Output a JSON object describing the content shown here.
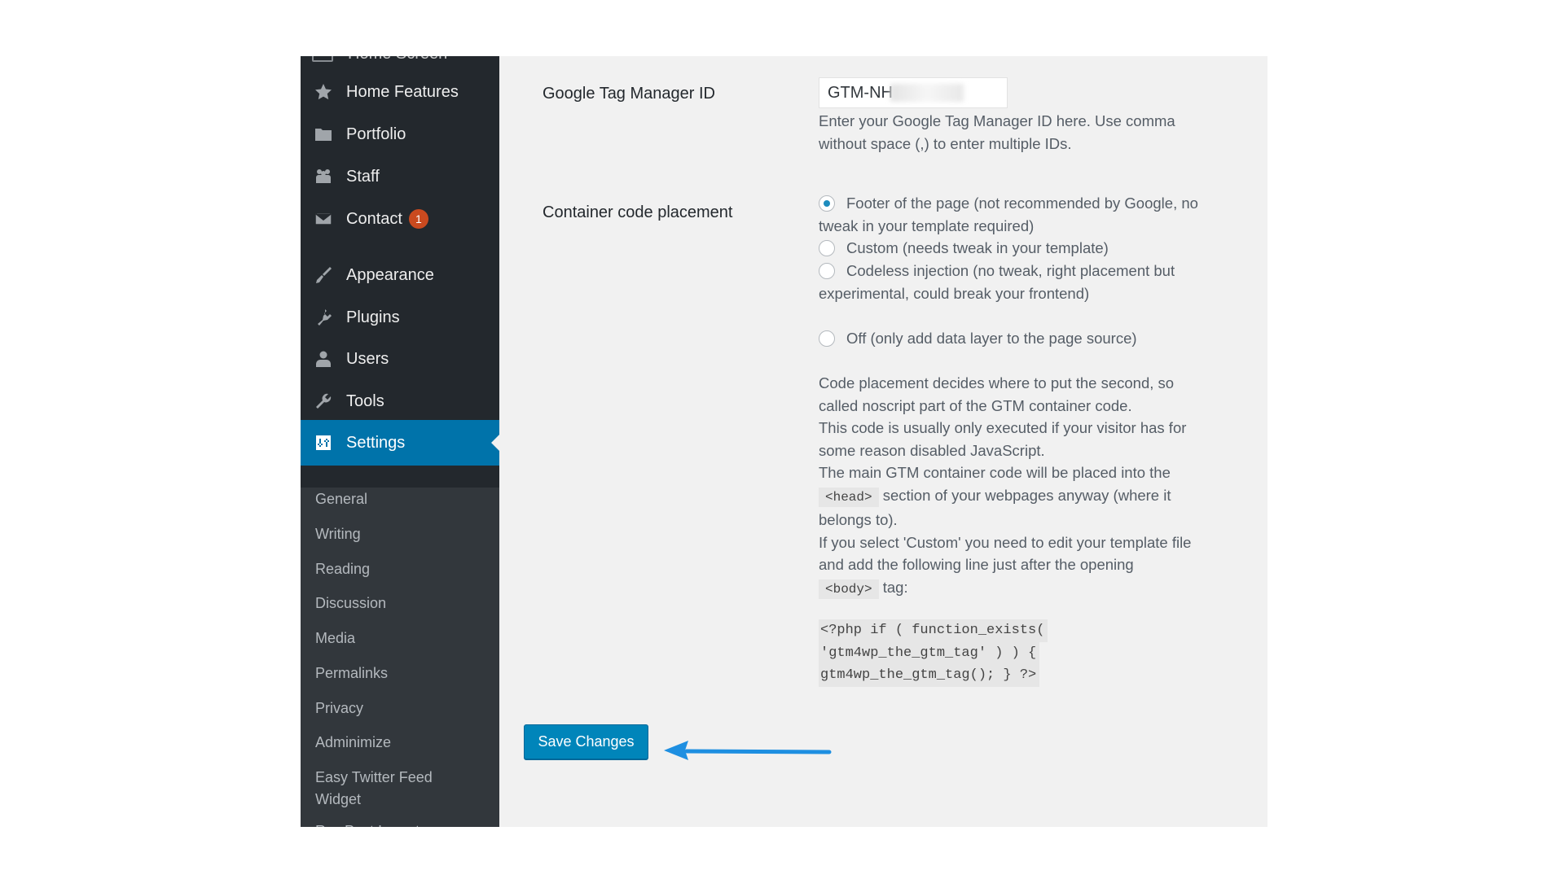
{
  "sidebar": {
    "top_partial_item": "Home Screen",
    "items": [
      {
        "label": "Home Features",
        "icon": "star-icon"
      },
      {
        "label": "Portfolio",
        "icon": "folder-icon"
      },
      {
        "label": "Staff",
        "icon": "group-icon"
      },
      {
        "label": "Contact",
        "icon": "mail-icon",
        "badge": "1"
      },
      {
        "label": "Appearance",
        "icon": "paintbrush-icon"
      },
      {
        "label": "Plugins",
        "icon": "plugin-icon"
      },
      {
        "label": "Users",
        "icon": "user-icon"
      },
      {
        "label": "Tools",
        "icon": "wrench-icon"
      },
      {
        "label": "Settings",
        "icon": "settings-icon",
        "active": true
      }
    ],
    "submenu": [
      "General",
      "Writing",
      "Reading",
      "Discussion",
      "Media",
      "Permalinks",
      "Privacy",
      "Adminimize",
      "Easy Twitter Feed Widget",
      "Rss Post Importer"
    ]
  },
  "form": {
    "gtm_id": {
      "label": "Google Tag Manager ID",
      "value": "GTM-NH",
      "description": "Enter your Google Tag Manager ID here. Use comma without space (,) to enter multiple IDs."
    },
    "placement": {
      "label": "Container code placement",
      "options": [
        {
          "label": "Footer of the page (not recommended by Google, no tweak in your template required)",
          "checked": true
        },
        {
          "label": "Custom (needs tweak in your template)",
          "checked": false
        },
        {
          "label": "Codeless injection (no tweak, right placement but experimental, could break your frontend)",
          "checked": false
        },
        {
          "label": "Off (only add data layer to the page source)",
          "checked": false
        }
      ],
      "help": {
        "p1": "Code placement decides where to put the second, so called noscript part of the GTM container code.",
        "p2": "This code is usually only executed if your visitor has for some reason disabled JavaScript.",
        "p3_before": "The main GTM container code will be placed into the",
        "p3_code": "<head>",
        "p3_after": "section of your webpages anyway (where it belongs to).",
        "p4_before": "If you select 'Custom' you need to edit your template file and add the following line just after the opening",
        "p4_code": "<body>",
        "p4_after": "tag:",
        "code_lines": [
          " <?php if ( function_exists(",
          "'gtm4wp_the_gtm_tag' ) ) {",
          "gtm4wp_the_gtm_tag(); } ?>"
        ]
      }
    },
    "save_label": "Save Changes"
  },
  "colors": {
    "sidebar_bg": "#23282d",
    "submenu_bg": "#32373c",
    "active_bg": "#0073aa",
    "badge": "#ca4a1f",
    "button": "#0085ba",
    "annotation_arrow": "#1e8fe1"
  }
}
